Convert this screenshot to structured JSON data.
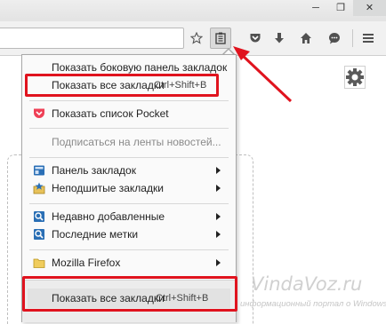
{
  "window": {
    "minimize_glyph": "─",
    "maximize_glyph": "❐",
    "close_glyph": "✕"
  },
  "toolbar": {
    "icons": [
      "star-icon",
      "bookmarks-menu-icon",
      "pocket-icon",
      "download-icon",
      "home-icon",
      "chat-icon",
      "hamburger-menu-icon"
    ],
    "active_button": "bookmarks-menu-icon"
  },
  "menu": {
    "items": [
      {
        "label": "Показать боковую панель закладок"
      },
      {
        "label": "Показать все закладки",
        "shortcut": "Ctrl+Shift+B"
      },
      {
        "label": "Показать список Pocket",
        "icon": "pocket-icon"
      },
      {
        "label": "Подписаться на ленты новостей...",
        "disabled": true
      },
      {
        "label": "Панель закладок",
        "icon": "bookmarks-toolbar-icon",
        "submenu": true
      },
      {
        "label": "Неподшитые закладки",
        "icon": "unsorted-bookmarks-icon",
        "submenu": true
      },
      {
        "label": "Недавно добавленные",
        "icon": "recent-icon",
        "submenu": true
      },
      {
        "label": "Последние метки",
        "icon": "tags-icon",
        "submenu": true
      },
      {
        "label": "Mozilla Firefox",
        "icon": "folder-icon",
        "submenu": true
      }
    ],
    "footer": {
      "label": "Показать все закладки",
      "shortcut": "Ctrl+Shift+B"
    }
  },
  "watermark": {
    "logo_text": "VindaVoz.ru",
    "tagline": "информационный портал о Windows"
  },
  "colors": {
    "highlight": "#e0131e",
    "pocket": "#ef4056",
    "accent_blue": "#2a6fb5"
  }
}
